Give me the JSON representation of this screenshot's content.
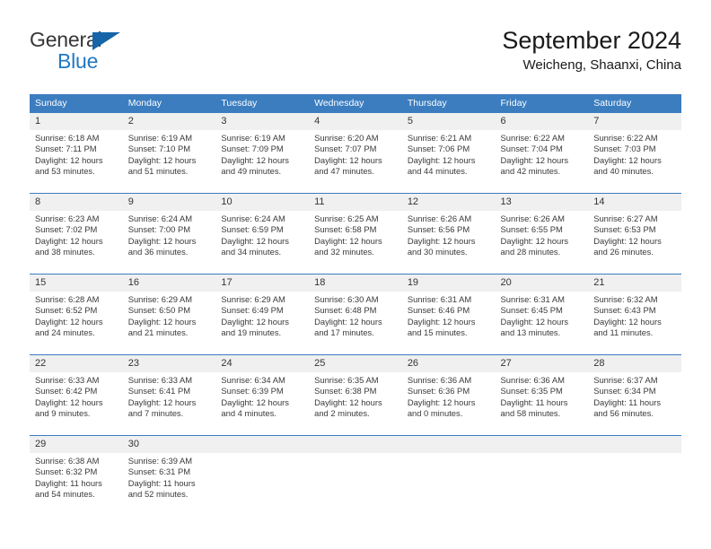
{
  "brand": {
    "name_part1": "General",
    "name_part2": "Blue",
    "triangle_color": "#1565a8",
    "blue": "#2079c4"
  },
  "header": {
    "title": "September 2024",
    "subtitle": "Weicheng, Shaanxi, China"
  },
  "theme": {
    "header_blue": "#3b7dbf",
    "daynum_band": "#f0f0f0",
    "text": "#3a3a3a"
  },
  "weekdays": [
    "Sunday",
    "Monday",
    "Tuesday",
    "Wednesday",
    "Thursday",
    "Friday",
    "Saturday"
  ],
  "labels": {
    "sunrise": "Sunrise:",
    "sunset": "Sunset:",
    "daylight": "Daylight:"
  },
  "weeks": [
    [
      {
        "day": "1",
        "sunrise": "Sunrise: 6:18 AM",
        "sunset": "Sunset: 7:11 PM",
        "daylight": "Daylight: 12 hours and 53 minutes."
      },
      {
        "day": "2",
        "sunrise": "Sunrise: 6:19 AM",
        "sunset": "Sunset: 7:10 PM",
        "daylight": "Daylight: 12 hours and 51 minutes."
      },
      {
        "day": "3",
        "sunrise": "Sunrise: 6:19 AM",
        "sunset": "Sunset: 7:09 PM",
        "daylight": "Daylight: 12 hours and 49 minutes."
      },
      {
        "day": "4",
        "sunrise": "Sunrise: 6:20 AM",
        "sunset": "Sunset: 7:07 PM",
        "daylight": "Daylight: 12 hours and 47 minutes."
      },
      {
        "day": "5",
        "sunrise": "Sunrise: 6:21 AM",
        "sunset": "Sunset: 7:06 PM",
        "daylight": "Daylight: 12 hours and 44 minutes."
      },
      {
        "day": "6",
        "sunrise": "Sunrise: 6:22 AM",
        "sunset": "Sunset: 7:04 PM",
        "daylight": "Daylight: 12 hours and 42 minutes."
      },
      {
        "day": "7",
        "sunrise": "Sunrise: 6:22 AM",
        "sunset": "Sunset: 7:03 PM",
        "daylight": "Daylight: 12 hours and 40 minutes."
      }
    ],
    [
      {
        "day": "8",
        "sunrise": "Sunrise: 6:23 AM",
        "sunset": "Sunset: 7:02 PM",
        "daylight": "Daylight: 12 hours and 38 minutes."
      },
      {
        "day": "9",
        "sunrise": "Sunrise: 6:24 AM",
        "sunset": "Sunset: 7:00 PM",
        "daylight": "Daylight: 12 hours and 36 minutes."
      },
      {
        "day": "10",
        "sunrise": "Sunrise: 6:24 AM",
        "sunset": "Sunset: 6:59 PM",
        "daylight": "Daylight: 12 hours and 34 minutes."
      },
      {
        "day": "11",
        "sunrise": "Sunrise: 6:25 AM",
        "sunset": "Sunset: 6:58 PM",
        "daylight": "Daylight: 12 hours and 32 minutes."
      },
      {
        "day": "12",
        "sunrise": "Sunrise: 6:26 AM",
        "sunset": "Sunset: 6:56 PM",
        "daylight": "Daylight: 12 hours and 30 minutes."
      },
      {
        "day": "13",
        "sunrise": "Sunrise: 6:26 AM",
        "sunset": "Sunset: 6:55 PM",
        "daylight": "Daylight: 12 hours and 28 minutes."
      },
      {
        "day": "14",
        "sunrise": "Sunrise: 6:27 AM",
        "sunset": "Sunset: 6:53 PM",
        "daylight": "Daylight: 12 hours and 26 minutes."
      }
    ],
    [
      {
        "day": "15",
        "sunrise": "Sunrise: 6:28 AM",
        "sunset": "Sunset: 6:52 PM",
        "daylight": "Daylight: 12 hours and 24 minutes."
      },
      {
        "day": "16",
        "sunrise": "Sunrise: 6:29 AM",
        "sunset": "Sunset: 6:50 PM",
        "daylight": "Daylight: 12 hours and 21 minutes."
      },
      {
        "day": "17",
        "sunrise": "Sunrise: 6:29 AM",
        "sunset": "Sunset: 6:49 PM",
        "daylight": "Daylight: 12 hours and 19 minutes."
      },
      {
        "day": "18",
        "sunrise": "Sunrise: 6:30 AM",
        "sunset": "Sunset: 6:48 PM",
        "daylight": "Daylight: 12 hours and 17 minutes."
      },
      {
        "day": "19",
        "sunrise": "Sunrise: 6:31 AM",
        "sunset": "Sunset: 6:46 PM",
        "daylight": "Daylight: 12 hours and 15 minutes."
      },
      {
        "day": "20",
        "sunrise": "Sunrise: 6:31 AM",
        "sunset": "Sunset: 6:45 PM",
        "daylight": "Daylight: 12 hours and 13 minutes."
      },
      {
        "day": "21",
        "sunrise": "Sunrise: 6:32 AM",
        "sunset": "Sunset: 6:43 PM",
        "daylight": "Daylight: 12 hours and 11 minutes."
      }
    ],
    [
      {
        "day": "22",
        "sunrise": "Sunrise: 6:33 AM",
        "sunset": "Sunset: 6:42 PM",
        "daylight": "Daylight: 12 hours and 9 minutes."
      },
      {
        "day": "23",
        "sunrise": "Sunrise: 6:33 AM",
        "sunset": "Sunset: 6:41 PM",
        "daylight": "Daylight: 12 hours and 7 minutes."
      },
      {
        "day": "24",
        "sunrise": "Sunrise: 6:34 AM",
        "sunset": "Sunset: 6:39 PM",
        "daylight": "Daylight: 12 hours and 4 minutes."
      },
      {
        "day": "25",
        "sunrise": "Sunrise: 6:35 AM",
        "sunset": "Sunset: 6:38 PM",
        "daylight": "Daylight: 12 hours and 2 minutes."
      },
      {
        "day": "26",
        "sunrise": "Sunrise: 6:36 AM",
        "sunset": "Sunset: 6:36 PM",
        "daylight": "Daylight: 12 hours and 0 minutes."
      },
      {
        "day": "27",
        "sunrise": "Sunrise: 6:36 AM",
        "sunset": "Sunset: 6:35 PM",
        "daylight": "Daylight: 11 hours and 58 minutes."
      },
      {
        "day": "28",
        "sunrise": "Sunrise: 6:37 AM",
        "sunset": "Sunset: 6:34 PM",
        "daylight": "Daylight: 11 hours and 56 minutes."
      }
    ],
    [
      {
        "day": "29",
        "sunrise": "Sunrise: 6:38 AM",
        "sunset": "Sunset: 6:32 PM",
        "daylight": "Daylight: 11 hours and 54 minutes."
      },
      {
        "day": "30",
        "sunrise": "Sunrise: 6:39 AM",
        "sunset": "Sunset: 6:31 PM",
        "daylight": "Daylight: 11 hours and 52 minutes."
      },
      {
        "day": "",
        "sunrise": "",
        "sunset": "",
        "daylight": ""
      },
      {
        "day": "",
        "sunrise": "",
        "sunset": "",
        "daylight": ""
      },
      {
        "day": "",
        "sunrise": "",
        "sunset": "",
        "daylight": ""
      },
      {
        "day": "",
        "sunrise": "",
        "sunset": "",
        "daylight": ""
      },
      {
        "day": "",
        "sunrise": "",
        "sunset": "",
        "daylight": ""
      }
    ]
  ]
}
